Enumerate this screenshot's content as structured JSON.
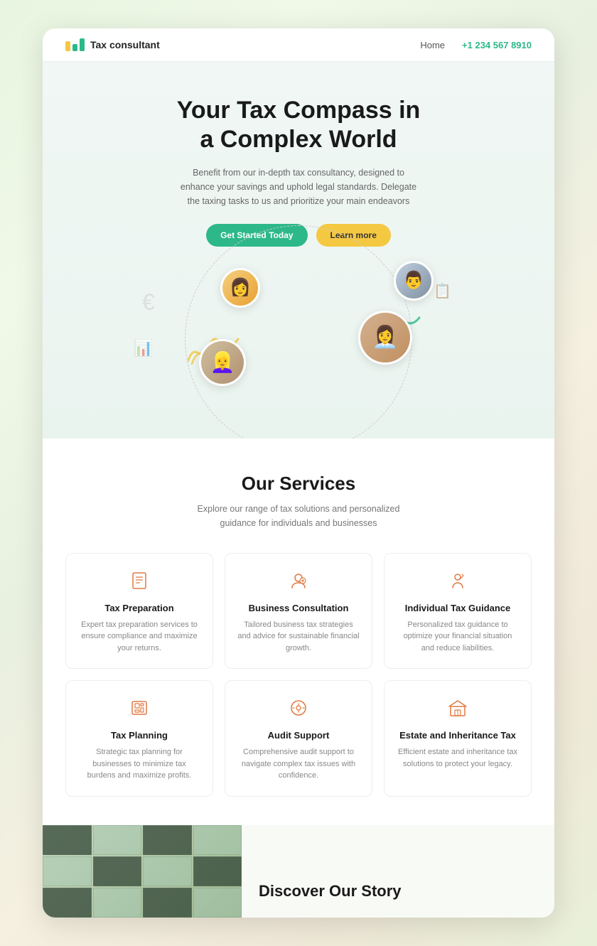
{
  "header": {
    "logo_text": "Tax consultant",
    "nav_home": "Home",
    "nav_phone": "+1 234 567 8910"
  },
  "hero": {
    "title_line1": "Your Tax Compass in",
    "title_line2": "a Complex World",
    "subtitle": "Benefit from our in-depth tax consultancy, designed to enhance your savings and uphold legal standards. Delegate the taxing tasks to us and prioritize your main endeavors",
    "btn_primary": "Get Started Today",
    "btn_secondary": "Learn more"
  },
  "services": {
    "section_title": "Our Services",
    "section_subtitle": "Explore our range of tax solutions and personalized guidance for individuals and businesses",
    "cards": [
      {
        "icon": "📋",
        "title": "Tax Preparation",
        "desc": "Expert tax preparation services to ensure compliance and maximize your returns."
      },
      {
        "icon": "💬",
        "title": "Business Consultation",
        "desc": "Tailored business tax strategies and advice for sustainable financial growth."
      },
      {
        "icon": "👤",
        "title": "Individual Tax Guidance",
        "desc": "Personalized tax guidance to optimize your financial situation and reduce liabilities."
      },
      {
        "icon": "📚",
        "title": "Tax Planning",
        "desc": "Strategic tax planning for businesses to minimize tax burdens and maximize profits."
      },
      {
        "icon": "🎧",
        "title": "Audit Support",
        "desc": "Comprehensive audit support to navigate complex tax issues with confidence."
      },
      {
        "icon": "📄",
        "title": "Estate and Inheritance Tax",
        "desc": "Efficient estate and inheritance tax solutions to protect your legacy."
      }
    ]
  },
  "discover": {
    "title": "Discover Our Story"
  },
  "colors": {
    "accent_green": "#2db88a",
    "accent_yellow": "#f5c842",
    "accent_orange": "#e07840"
  }
}
